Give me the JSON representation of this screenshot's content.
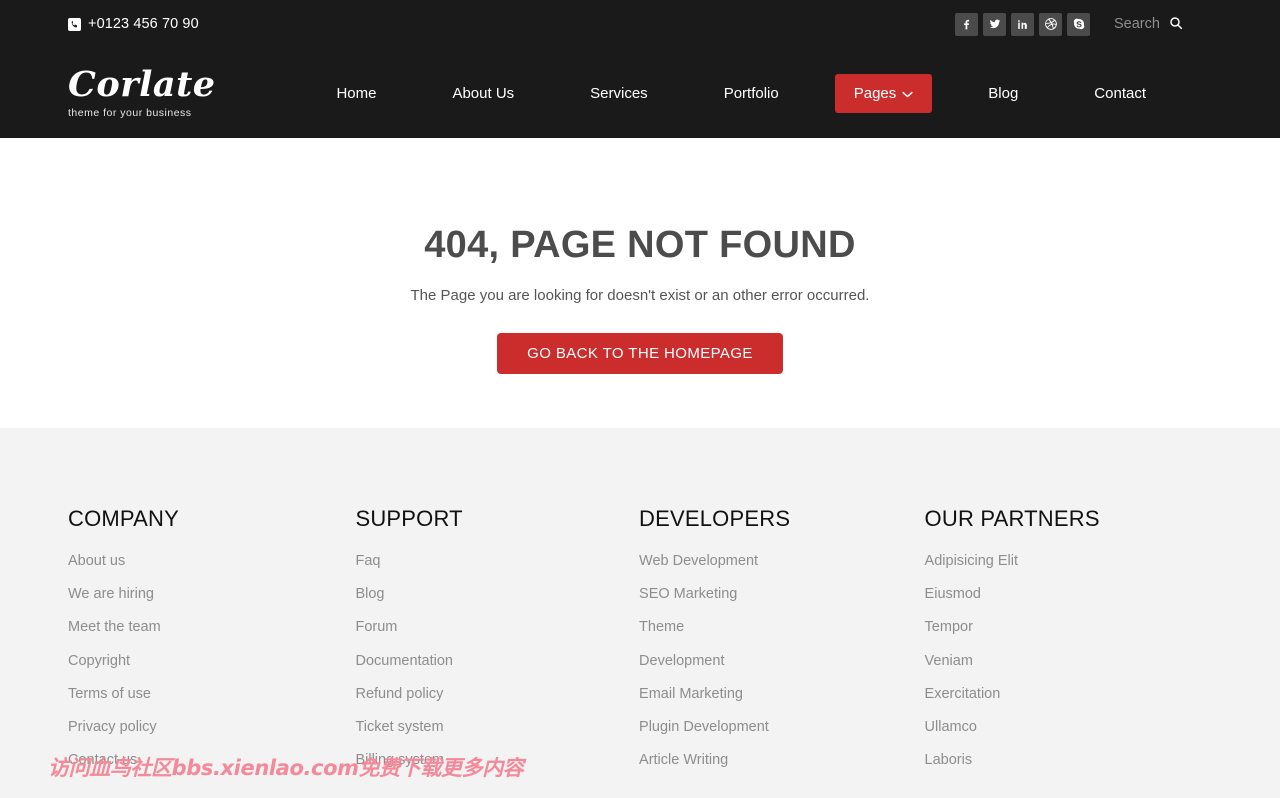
{
  "topbar": {
    "phone": "+0123 456 70 90",
    "phone_icon": "phone-icon",
    "socials": [
      {
        "name": "facebook",
        "glyph": "f"
      },
      {
        "name": "twitter",
        "glyph": "t"
      },
      {
        "name": "linkedin",
        "glyph": "in"
      },
      {
        "name": "dribbble",
        "glyph": "d"
      },
      {
        "name": "skype",
        "glyph": "S"
      }
    ],
    "search": {
      "placeholder": "Search",
      "value": "",
      "icon": "search-icon"
    }
  },
  "brand": {
    "name": "Corlate",
    "tagline": "theme for your business"
  },
  "nav": {
    "items": [
      {
        "label": "Home",
        "active": false
      },
      {
        "label": "About Us",
        "active": false
      },
      {
        "label": "Services",
        "active": false
      },
      {
        "label": "Portfolio",
        "active": false
      },
      {
        "label": "Pages",
        "active": true,
        "icon": "chevron-down-icon"
      },
      {
        "label": "Blog",
        "active": false
      },
      {
        "label": "Contact",
        "active": false
      }
    ]
  },
  "error_page": {
    "title": "404, PAGE NOT FOUND",
    "subtitle": "The Page you are looking for doesn't exist or an other error occurred.",
    "button_label": "GO BACK TO THE HOMEPAGE"
  },
  "footer": {
    "columns": [
      {
        "title": "COMPANY",
        "links": [
          "About us",
          "We are hiring",
          "Meet the team",
          "Copyright",
          "Terms of use",
          "Privacy policy",
          "Contact us"
        ]
      },
      {
        "title": "SUPPORT",
        "links": [
          "Faq",
          "Blog",
          "Forum",
          "Documentation",
          "Refund policy",
          "Ticket system",
          "Billing system"
        ]
      },
      {
        "title": "DEVELOPERS",
        "links": [
          "Web Development",
          "SEO Marketing",
          "Theme",
          "Development",
          "Email Marketing",
          "Plugin Development",
          "Article Writing"
        ]
      },
      {
        "title": "OUR PARTNERS",
        "links": [
          "Adipisicing Elit",
          "Eiusmod",
          "Tempor",
          "Veniam",
          "Exercitation",
          "Ullamco",
          "Laboris"
        ]
      }
    ]
  },
  "watermark": "访问血鸟社区bbs.xienlao.com免费下载更多内容",
  "colors": {
    "header_bg": "#1a1a1a",
    "accent_red": "#cb2d2d",
    "footer_bg": "#f3f3f3",
    "social_tile": "#4b4b4b",
    "watermark": "#f4899a"
  }
}
